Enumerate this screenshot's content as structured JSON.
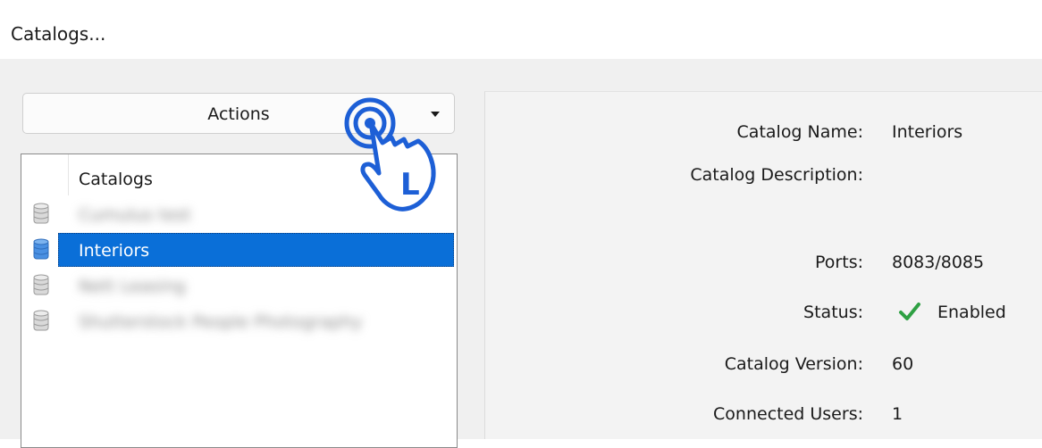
{
  "window": {
    "title": "Catalogs..."
  },
  "actions": {
    "label": "Actions"
  },
  "catalog_list": {
    "header": "Catalogs",
    "items": [
      {
        "label": "Cumulus test",
        "blurred": true,
        "selected": false
      },
      {
        "label": "Interiors",
        "blurred": false,
        "selected": true
      },
      {
        "label": "Nett Leasing",
        "blurred": true,
        "selected": false
      },
      {
        "label": "Shutterstock People Photography",
        "blurred": true,
        "selected": false
      }
    ]
  },
  "details": {
    "catalog_name_label": "Catalog Name:",
    "catalog_name_value": "Interiors",
    "catalog_description_label": "Catalog Description:",
    "ports_label": "Ports:",
    "ports_value": "8083/8085",
    "status_label": "Status:",
    "status_value": "Enabled",
    "catalog_version_label": "Catalog Version:",
    "catalog_version_value": "60",
    "connected_users_label": "Connected Users:",
    "connected_users_value": "1"
  },
  "gesture": {
    "letter": "L",
    "icon": "tap-hand-icon"
  },
  "colors": {
    "selection": "#0a6fd8",
    "check": "#2ea043",
    "gesture_blue": "#1d5fd6"
  }
}
